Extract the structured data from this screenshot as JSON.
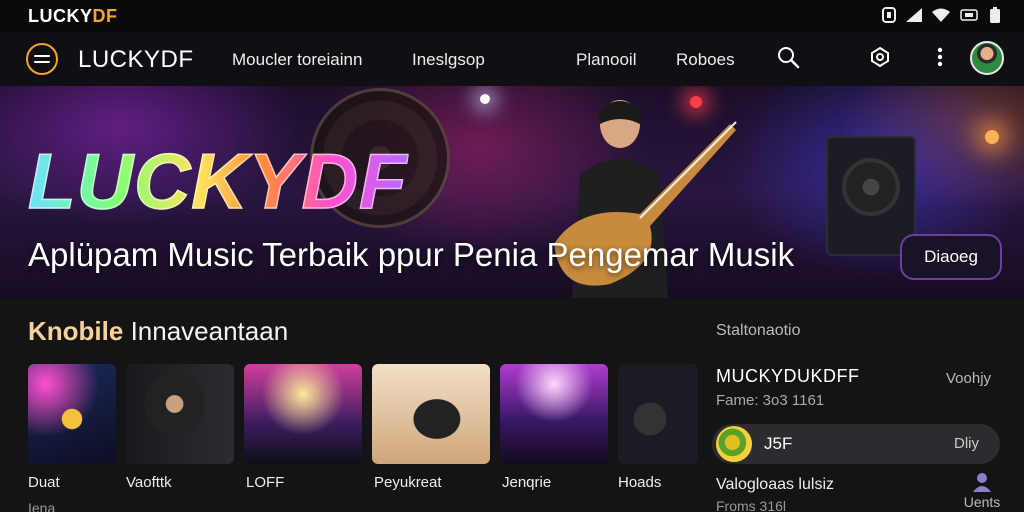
{
  "status_bar": {
    "logo_main": "LUCKY",
    "logo_accent": "DF"
  },
  "nav": {
    "brand": "LUCKYDF",
    "links": [
      "Moucler toreiainn",
      "Ineslgsop",
      "Planooil",
      "Roboes"
    ]
  },
  "hero": {
    "title": "LUCKYDF",
    "subtitle": "Aplüpam Music Terbaik ppur Penia Pengemar Musik",
    "button_label": "Diaoeg"
  },
  "section": {
    "title_highlight": "Knobile",
    "title_rest": "Innaveantaan",
    "items": [
      {
        "label": "Duat"
      },
      {
        "label": "Vaofttk"
      },
      {
        "label": "LOFF"
      },
      {
        "label": "Peyukreat"
      },
      {
        "label": "Jenqrie"
      },
      {
        "label": "Hoads"
      }
    ],
    "sub_label": "Iena"
  },
  "panel": {
    "label": "Staltonaotio",
    "name": "MUCKYDUKDFF",
    "side": "Voohjy",
    "meta": "Fame: 3o3 1161",
    "player": {
      "title": "J5F",
      "right": "Dliy"
    },
    "name2": "Valogloaas lulsiz",
    "meta2": "Froms 316l",
    "user_label": "Uents"
  },
  "colors": {
    "accent": "#f5a623",
    "hero_button_border": "#6a3fa0",
    "background": "#141416"
  }
}
